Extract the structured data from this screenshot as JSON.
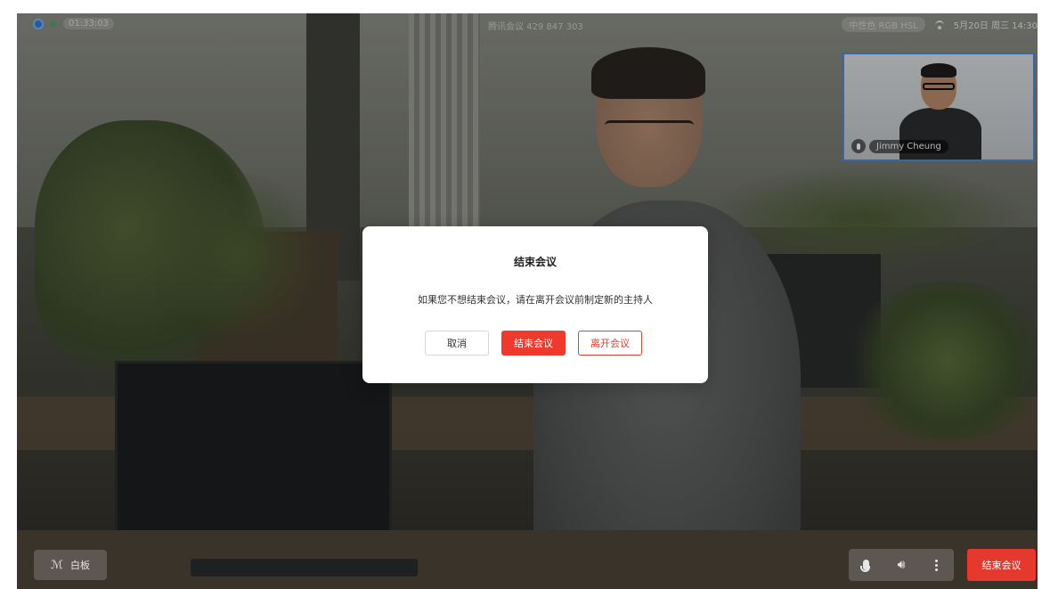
{
  "status_bar": {
    "timer": "01:33:03",
    "meeting_info": "腾讯会议 429 847 303",
    "rgb_pill": "中性色 RGB HSL",
    "datetime": "5月20日 周三 14:30"
  },
  "pip": {
    "participant_name": "Jimmy Cheung"
  },
  "dialog": {
    "title": "结束会议",
    "message": "如果您不想结束会议，请在离开会议前制定新的主持人",
    "cancel_label": "取消",
    "end_label": "结束会议",
    "leave_label": "离开会议"
  },
  "toolbar": {
    "whiteboard_label": "白板",
    "end_meeting_label": "结束会议"
  },
  "icons": {
    "mic": "microphone-icon",
    "speaker": "speaker-icon",
    "more": "more-vertical-icon",
    "pen": "pen-icon",
    "wifi": "wifi-icon"
  },
  "colors": {
    "accent_red": "#ee3a2d",
    "pip_border": "#4f86d6"
  }
}
